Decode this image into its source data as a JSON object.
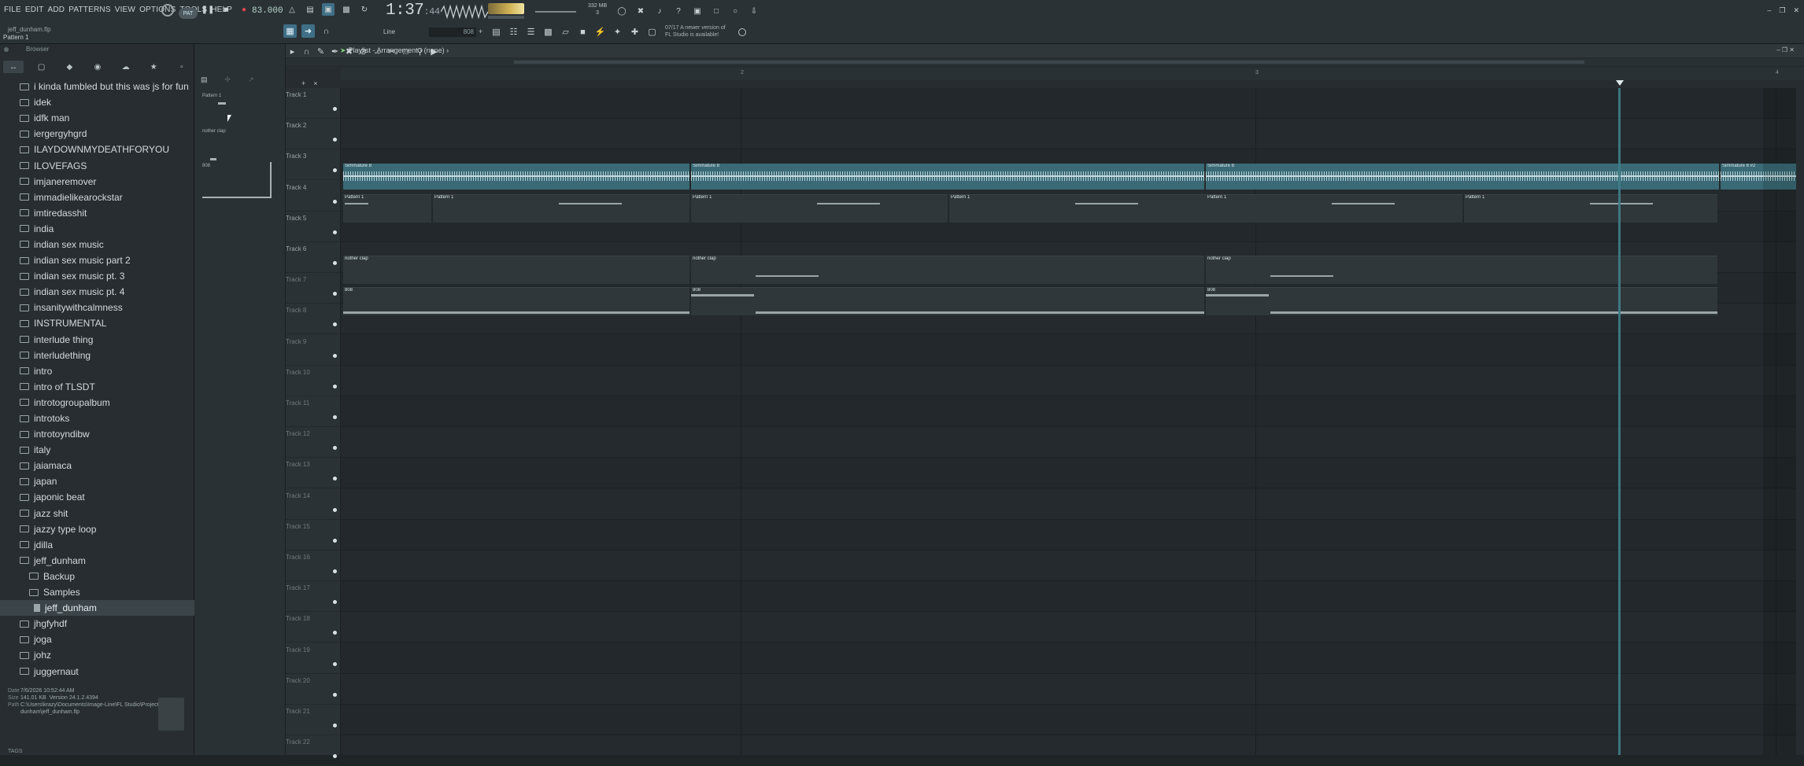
{
  "menu": [
    "FILE",
    "EDIT",
    "ADD",
    "PATTERNS",
    "VIEW",
    "OPTIONS",
    "TOOLS",
    "HELP"
  ],
  "project": {
    "name": "jeff_dunham.flp",
    "pattern": "Pattern 1"
  },
  "transport": {
    "mode": "PAT",
    "tempo": "83.000",
    "time_main": "1:37",
    "time_sub": ":44",
    "cpu_mem": "332 MB",
    "cpu_val": "3"
  },
  "hint": {
    "line1": "07/17  A newer version of",
    "line2": "FL Studio is available!"
  },
  "toolbar": {
    "snap": "Line",
    "pattern_field": "808"
  },
  "browser": {
    "title": "Browser",
    "items": [
      {
        "label": "i kinda fumbled but this was js for fun",
        "type": "folder"
      },
      {
        "label": "idek",
        "type": "folder"
      },
      {
        "label": "idfk man",
        "type": "folder"
      },
      {
        "label": "iergergyhgrd",
        "type": "folder"
      },
      {
        "label": "ILAYDOWNMYDEATHFORYOU",
        "type": "folder"
      },
      {
        "label": "ILOVEFAGS",
        "type": "folder"
      },
      {
        "label": "imjaneremover",
        "type": "folder"
      },
      {
        "label": "immadielikearockstar",
        "type": "folder"
      },
      {
        "label": "imtiredasshit",
        "type": "folder"
      },
      {
        "label": "india",
        "type": "folder"
      },
      {
        "label": "indian sex music",
        "type": "folder"
      },
      {
        "label": "indian sex music part 2",
        "type": "folder"
      },
      {
        "label": "indian sex music pt. 3",
        "type": "folder"
      },
      {
        "label": "indian sex music pt. 4",
        "type": "folder"
      },
      {
        "label": "insanitywithcalmness",
        "type": "folder"
      },
      {
        "label": "INSTRUMENTAL",
        "type": "folder"
      },
      {
        "label": "interlude thing",
        "type": "folder"
      },
      {
        "label": "interludething",
        "type": "folder"
      },
      {
        "label": "intro",
        "type": "folder"
      },
      {
        "label": "intro of TLSDT",
        "type": "folder"
      },
      {
        "label": "introtogroupalbum",
        "type": "folder"
      },
      {
        "label": "introtoks",
        "type": "folder"
      },
      {
        "label": "introtoyndibw",
        "type": "folder"
      },
      {
        "label": "italy",
        "type": "folder"
      },
      {
        "label": "jaiamaca",
        "type": "folder"
      },
      {
        "label": "japan",
        "type": "folder"
      },
      {
        "label": "japonic beat",
        "type": "folder"
      },
      {
        "label": "jazz shit",
        "type": "folder"
      },
      {
        "label": "jazzy type loop",
        "type": "folder"
      },
      {
        "label": "jdilla",
        "type": "folder"
      },
      {
        "label": "jeff_dunham",
        "type": "folder"
      },
      {
        "label": "Backup",
        "type": "subfolder"
      },
      {
        "label": "Samples",
        "type": "subfolder"
      },
      {
        "label": "jeff_dunham",
        "type": "file",
        "selected": true
      },
      {
        "label": "jhgfyhdf",
        "type": "folder"
      },
      {
        "label": "joga",
        "type": "folder"
      },
      {
        "label": "johz",
        "type": "folder"
      },
      {
        "label": "juggernaut",
        "type": "folder"
      }
    ],
    "footer": {
      "date_key": "Date",
      "date": "7/6/2026 10:52:44 AM",
      "size_key": "Size",
      "size": "141.01 KB",
      "version": "Version 24.1.2.4394",
      "path_key": "Path",
      "path1": "C:\\Users\\krazy\\Documents\\Image-Line\\FL Studio\\Projects\\jeff_",
      "path2": "dunham\\jeff_dunham.flp"
    },
    "tags": "TAGS"
  },
  "picker": {
    "items": [
      "Pattern 1",
      "nother clap",
      "808"
    ]
  },
  "playlist": {
    "title": "Playlist - Arrangement",
    "subtitle": "(none)",
    "ruler": [
      "2",
      "3",
      "4"
    ],
    "tracks": [
      "Track 1",
      "Track 2",
      "Track 3",
      "Track 4",
      "Track 5",
      "Track 6",
      "Track 7",
      "Track 8",
      "Track 9",
      "Track 10",
      "Track 11",
      "Track 12",
      "Track 13",
      "Track 14",
      "Track 15",
      "Track 16",
      "Track 17",
      "Track 18",
      "Track 19",
      "Track 20",
      "Track 21",
      "Track 22"
    ],
    "audio_clips": [
      "Simmature 8",
      "Simmature 8",
      "Simmature 8",
      "Simmature 8 #2"
    ],
    "pattern_clips": [
      "Pattern 1",
      "Pattern 1",
      "Pattern 1",
      "Pattern 1",
      "Pattern 1",
      "Pattern 1"
    ],
    "clap_clips": [
      "nother clap",
      "nother clap",
      "nother clap"
    ],
    "bass_clips": [
      "808",
      "808",
      "808"
    ]
  },
  "colors": {
    "accent": "#3f6f86",
    "playhead": "#3f7e8a",
    "audio_clip": "#3a6a76",
    "record": "#e0464a"
  }
}
